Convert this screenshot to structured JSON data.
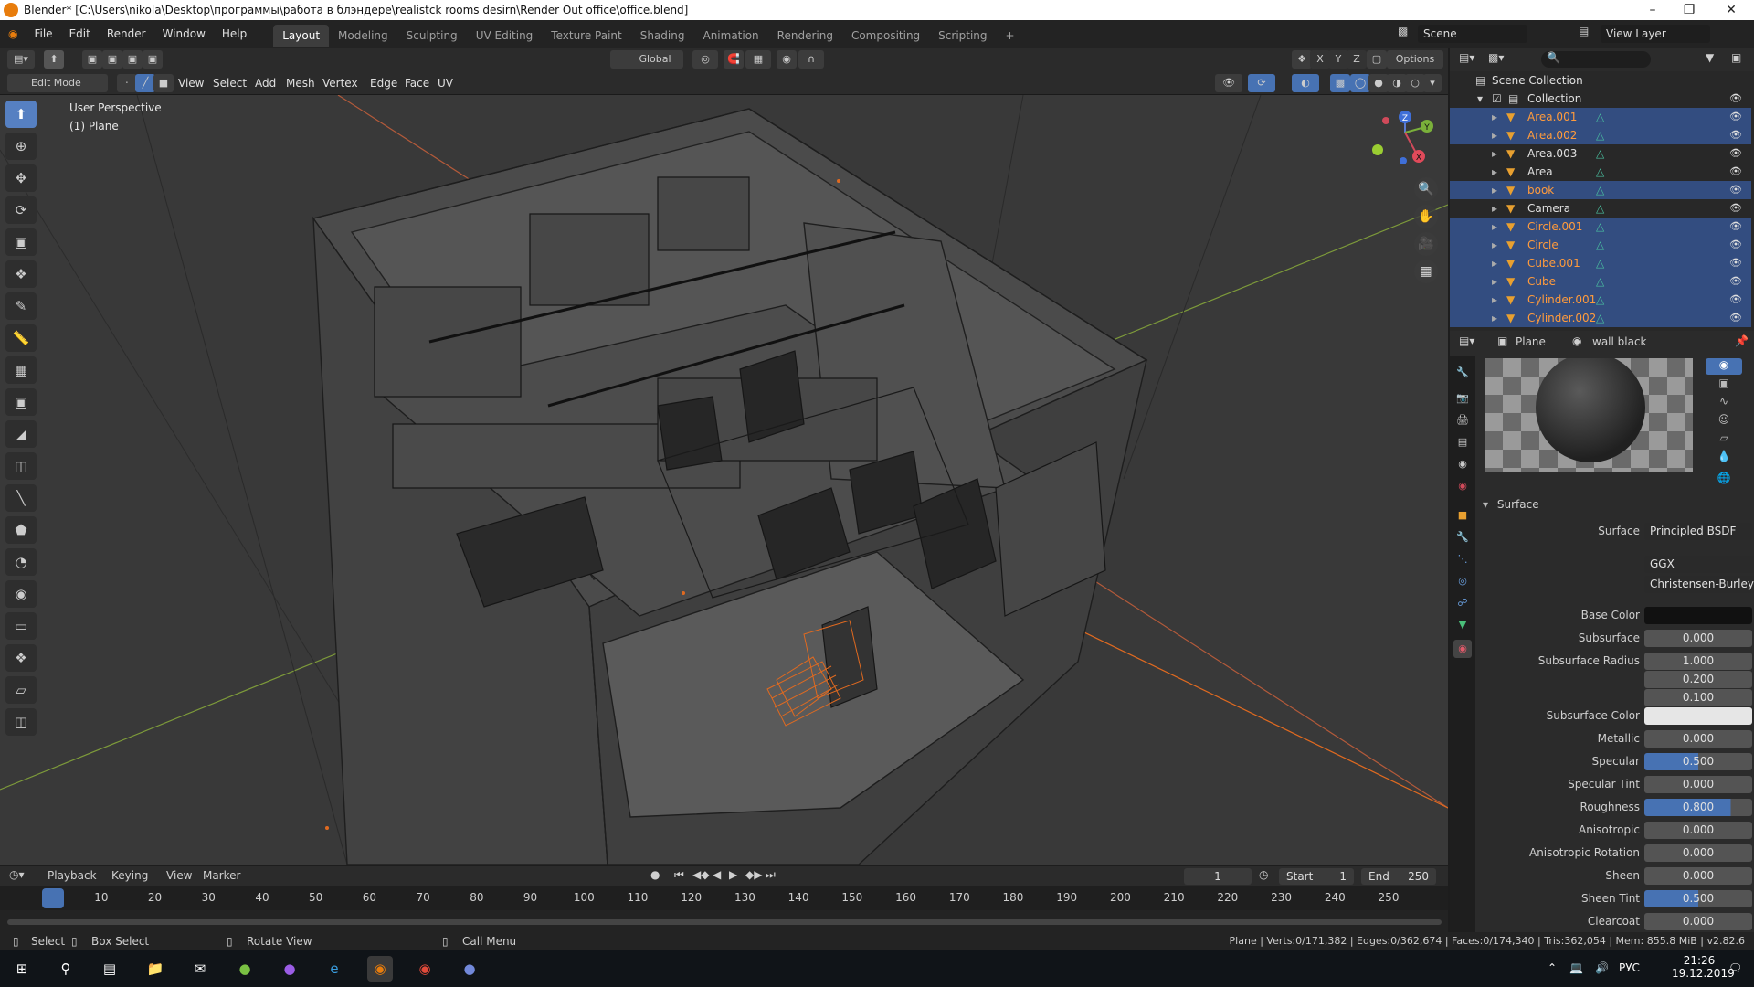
{
  "window": {
    "title": "Blender* [C:\\Users\\nikola\\Desktop\\программы\\работа в блэндере\\realistck rooms desirn\\Render Out office\\office.blend]"
  },
  "menu": {
    "items": [
      "File",
      "Edit",
      "Render",
      "Window",
      "Help"
    ],
    "workspaces": [
      "Layout",
      "Modeling",
      "Sculpting",
      "UV Editing",
      "Texture Paint",
      "Shading",
      "Animation",
      "Rendering",
      "Compositing",
      "Scripting"
    ],
    "active_workspace": "Layout",
    "scene": "Scene",
    "view_layer": "View Layer"
  },
  "viewport_header": {
    "mode": "Edit Mode",
    "menus": [
      "View",
      "Select",
      "Add",
      "Mesh",
      "Vertex",
      "Edge",
      "Face",
      "UV"
    ],
    "orientation": "Global",
    "options": "Options",
    "axes": [
      "X",
      "Y",
      "Z"
    ]
  },
  "viewport": {
    "perspective": "User Perspective",
    "object": "(1) Plane",
    "gizmo_axes": [
      "Z",
      "Y",
      "X"
    ]
  },
  "outliner": {
    "scene_collection": "Scene Collection",
    "collection": "Collection",
    "items": [
      {
        "name": "Area.001",
        "selected": true
      },
      {
        "name": "Area.002",
        "selected": true
      },
      {
        "name": "Area.003",
        "selected": false
      },
      {
        "name": "Area",
        "selected": false
      },
      {
        "name": "book",
        "selected": true
      },
      {
        "name": "Camera",
        "selected": false
      },
      {
        "name": "Circle.001",
        "selected": true
      },
      {
        "name": "Circle",
        "selected": true
      },
      {
        "name": "Cube.001",
        "selected": true
      },
      {
        "name": "Cube",
        "selected": true
      },
      {
        "name": "Cylinder.001",
        "selected": true
      },
      {
        "name": "Cylinder.002",
        "selected": true
      }
    ]
  },
  "properties": {
    "object": "Plane",
    "material": "wall black",
    "section": "Surface",
    "surface_shader": "Principled BSDF",
    "distribution": "GGX",
    "subsurface_method": "Christensen-Burley",
    "rows": [
      {
        "label": "Base Color",
        "kind": "color",
        "color": "#111111"
      },
      {
        "label": "Subsurface",
        "value": "0.000"
      },
      {
        "label": "Subsurface Radius",
        "value": "1.000"
      },
      {
        "label": "",
        "value": "0.200"
      },
      {
        "label": "",
        "value": "0.100"
      },
      {
        "label": "Subsurface Color",
        "kind": "color",
        "color": "#e6e6e6"
      },
      {
        "label": "Metallic",
        "value": "0.000"
      },
      {
        "label": "Specular",
        "value": "0.500",
        "fill": 0.5
      },
      {
        "label": "Specular Tint",
        "value": "0.000"
      },
      {
        "label": "Roughness",
        "value": "0.800",
        "fill": 0.8
      },
      {
        "label": "Anisotropic",
        "value": "0.000"
      },
      {
        "label": "Anisotropic Rotation",
        "value": "0.000"
      },
      {
        "label": "Sheen",
        "value": "0.000"
      },
      {
        "label": "Sheen Tint",
        "value": "0.500",
        "fill": 0.5
      },
      {
        "label": "Clearcoat",
        "value": "0.000"
      }
    ]
  },
  "timeline": {
    "menus": [
      "Playback",
      "Keying",
      "View",
      "Marker"
    ],
    "current_frame": "1",
    "start_label": "Start",
    "start": "1",
    "end_label": "End",
    "end": "250",
    "ticks": [
      "1",
      "10",
      "20",
      "30",
      "40",
      "50",
      "60",
      "70",
      "80",
      "90",
      "100",
      "110",
      "120",
      "130",
      "140",
      "150",
      "160",
      "170",
      "180",
      "190",
      "200",
      "210",
      "220",
      "230",
      "240",
      "250"
    ]
  },
  "statusbar": {
    "select": "Select",
    "box_select": "Box Select",
    "rotate_view": "Rotate View",
    "call_menu": "Call Menu",
    "stats": "Plane | Verts:0/171,382 | Edges:0/362,674 | Faces:0/174,340 | Tris:362,054 | Mem: 855.8 MiB | v2.82.6"
  },
  "taskbar": {
    "lang": "РУС",
    "time": "21:26",
    "date": "19.12.2019"
  },
  "colors": {
    "accent_blue": "#4772b3",
    "selection_orange": "#ff9b3c",
    "viewport_bg": "#393939"
  }
}
